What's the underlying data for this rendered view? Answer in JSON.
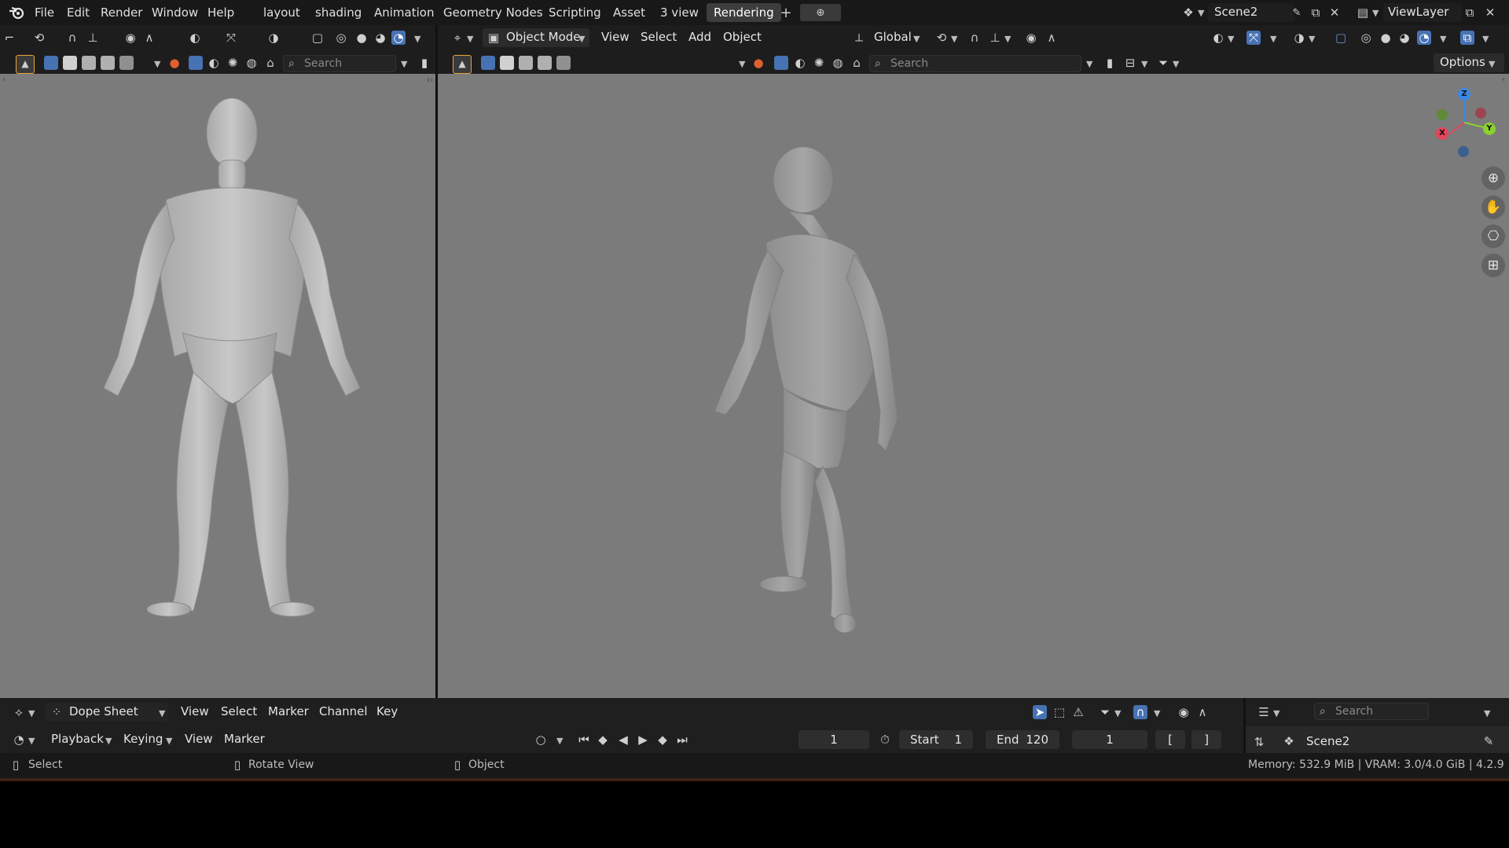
{
  "top_menu": [
    "File",
    "Edit",
    "Render",
    "Window",
    "Help"
  ],
  "workspace_tabs": [
    "layout",
    "shading",
    "Animation",
    "Geometry Nodes",
    "Scripting",
    "Asset",
    "3 view",
    "Rendering"
  ],
  "active_tab": "Rendering",
  "scene": {
    "name": "Scene2"
  },
  "view_layer": {
    "name": "ViewLayer"
  },
  "left_viewport": {
    "search_placeholder": "Search"
  },
  "right_viewport": {
    "mode": "Object Mode",
    "menus": [
      "View",
      "Select",
      "Add",
      "Object"
    ],
    "transform_orientation": "Global",
    "search_placeholder": "Search",
    "options_label": "Options",
    "gizmo_axes": {
      "z": "Z",
      "y": "Y",
      "x": "X"
    }
  },
  "dopesheet": {
    "editor": "Dope Sheet",
    "menus": [
      "View",
      "Select",
      "Marker",
      "Channel",
      "Key"
    ],
    "search_placeholder": "Search",
    "scene_label": "Scene2"
  },
  "timeline": {
    "menus": [
      "Playback",
      "Keying",
      "View",
      "Marker"
    ],
    "current_frame": "1",
    "start_label": "Start",
    "start": "1",
    "end_label": "End",
    "end": "120",
    "frame2": "1",
    "bracket_left": "[",
    "bracket_right": "]"
  },
  "statusbar": {
    "select": "Select",
    "rotate": "Rotate View",
    "object": "Object",
    "info": "Memory: 532.9 MiB | VRAM: 3.0/4.0 GiB | 4.2.9"
  },
  "colors": {
    "viewport_bg": "#7a7a7a",
    "active_blue": "#4772b3",
    "axis_x": "#e5455a",
    "axis_y": "#8bd130",
    "axis_z": "#3c87e6"
  }
}
